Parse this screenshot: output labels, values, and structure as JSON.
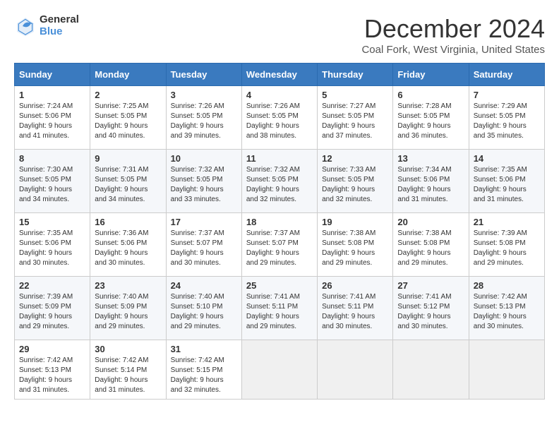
{
  "logo": {
    "general": "General",
    "blue": "Blue"
  },
  "title": {
    "month": "December 2024",
    "location": "Coal Fork, West Virginia, United States"
  },
  "calendar": {
    "headers": [
      "Sunday",
      "Monday",
      "Tuesday",
      "Wednesday",
      "Thursday",
      "Friday",
      "Saturday"
    ],
    "weeks": [
      [
        {
          "day": "1",
          "sunrise": "7:24 AM",
          "sunset": "5:06 PM",
          "daylight": "9 hours and 41 minutes."
        },
        {
          "day": "2",
          "sunrise": "7:25 AM",
          "sunset": "5:05 PM",
          "daylight": "9 hours and 40 minutes."
        },
        {
          "day": "3",
          "sunrise": "7:26 AM",
          "sunset": "5:05 PM",
          "daylight": "9 hours and 39 minutes."
        },
        {
          "day": "4",
          "sunrise": "7:26 AM",
          "sunset": "5:05 PM",
          "daylight": "9 hours and 38 minutes."
        },
        {
          "day": "5",
          "sunrise": "7:27 AM",
          "sunset": "5:05 PM",
          "daylight": "9 hours and 37 minutes."
        },
        {
          "day": "6",
          "sunrise": "7:28 AM",
          "sunset": "5:05 PM",
          "daylight": "9 hours and 36 minutes."
        },
        {
          "day": "7",
          "sunrise": "7:29 AM",
          "sunset": "5:05 PM",
          "daylight": "9 hours and 35 minutes."
        }
      ],
      [
        {
          "day": "8",
          "sunrise": "7:30 AM",
          "sunset": "5:05 PM",
          "daylight": "9 hours and 34 minutes."
        },
        {
          "day": "9",
          "sunrise": "7:31 AM",
          "sunset": "5:05 PM",
          "daylight": "9 hours and 34 minutes."
        },
        {
          "day": "10",
          "sunrise": "7:32 AM",
          "sunset": "5:05 PM",
          "daylight": "9 hours and 33 minutes."
        },
        {
          "day": "11",
          "sunrise": "7:32 AM",
          "sunset": "5:05 PM",
          "daylight": "9 hours and 32 minutes."
        },
        {
          "day": "12",
          "sunrise": "7:33 AM",
          "sunset": "5:05 PM",
          "daylight": "9 hours and 32 minutes."
        },
        {
          "day": "13",
          "sunrise": "7:34 AM",
          "sunset": "5:06 PM",
          "daylight": "9 hours and 31 minutes."
        },
        {
          "day": "14",
          "sunrise": "7:35 AM",
          "sunset": "5:06 PM",
          "daylight": "9 hours and 31 minutes."
        }
      ],
      [
        {
          "day": "15",
          "sunrise": "7:35 AM",
          "sunset": "5:06 PM",
          "daylight": "9 hours and 30 minutes."
        },
        {
          "day": "16",
          "sunrise": "7:36 AM",
          "sunset": "5:06 PM",
          "daylight": "9 hours and 30 minutes."
        },
        {
          "day": "17",
          "sunrise": "7:37 AM",
          "sunset": "5:07 PM",
          "daylight": "9 hours and 30 minutes."
        },
        {
          "day": "18",
          "sunrise": "7:37 AM",
          "sunset": "5:07 PM",
          "daylight": "9 hours and 29 minutes."
        },
        {
          "day": "19",
          "sunrise": "7:38 AM",
          "sunset": "5:08 PM",
          "daylight": "9 hours and 29 minutes."
        },
        {
          "day": "20",
          "sunrise": "7:38 AM",
          "sunset": "5:08 PM",
          "daylight": "9 hours and 29 minutes."
        },
        {
          "day": "21",
          "sunrise": "7:39 AM",
          "sunset": "5:08 PM",
          "daylight": "9 hours and 29 minutes."
        }
      ],
      [
        {
          "day": "22",
          "sunrise": "7:39 AM",
          "sunset": "5:09 PM",
          "daylight": "9 hours and 29 minutes."
        },
        {
          "day": "23",
          "sunrise": "7:40 AM",
          "sunset": "5:09 PM",
          "daylight": "9 hours and 29 minutes."
        },
        {
          "day": "24",
          "sunrise": "7:40 AM",
          "sunset": "5:10 PM",
          "daylight": "9 hours and 29 minutes."
        },
        {
          "day": "25",
          "sunrise": "7:41 AM",
          "sunset": "5:11 PM",
          "daylight": "9 hours and 29 minutes."
        },
        {
          "day": "26",
          "sunrise": "7:41 AM",
          "sunset": "5:11 PM",
          "daylight": "9 hours and 30 minutes."
        },
        {
          "day": "27",
          "sunrise": "7:41 AM",
          "sunset": "5:12 PM",
          "daylight": "9 hours and 30 minutes."
        },
        {
          "day": "28",
          "sunrise": "7:42 AM",
          "sunset": "5:13 PM",
          "daylight": "9 hours and 30 minutes."
        }
      ],
      [
        {
          "day": "29",
          "sunrise": "7:42 AM",
          "sunset": "5:13 PM",
          "daylight": "9 hours and 31 minutes."
        },
        {
          "day": "30",
          "sunrise": "7:42 AM",
          "sunset": "5:14 PM",
          "daylight": "9 hours and 31 minutes."
        },
        {
          "day": "31",
          "sunrise": "7:42 AM",
          "sunset": "5:15 PM",
          "daylight": "9 hours and 32 minutes."
        },
        null,
        null,
        null,
        null
      ]
    ]
  }
}
